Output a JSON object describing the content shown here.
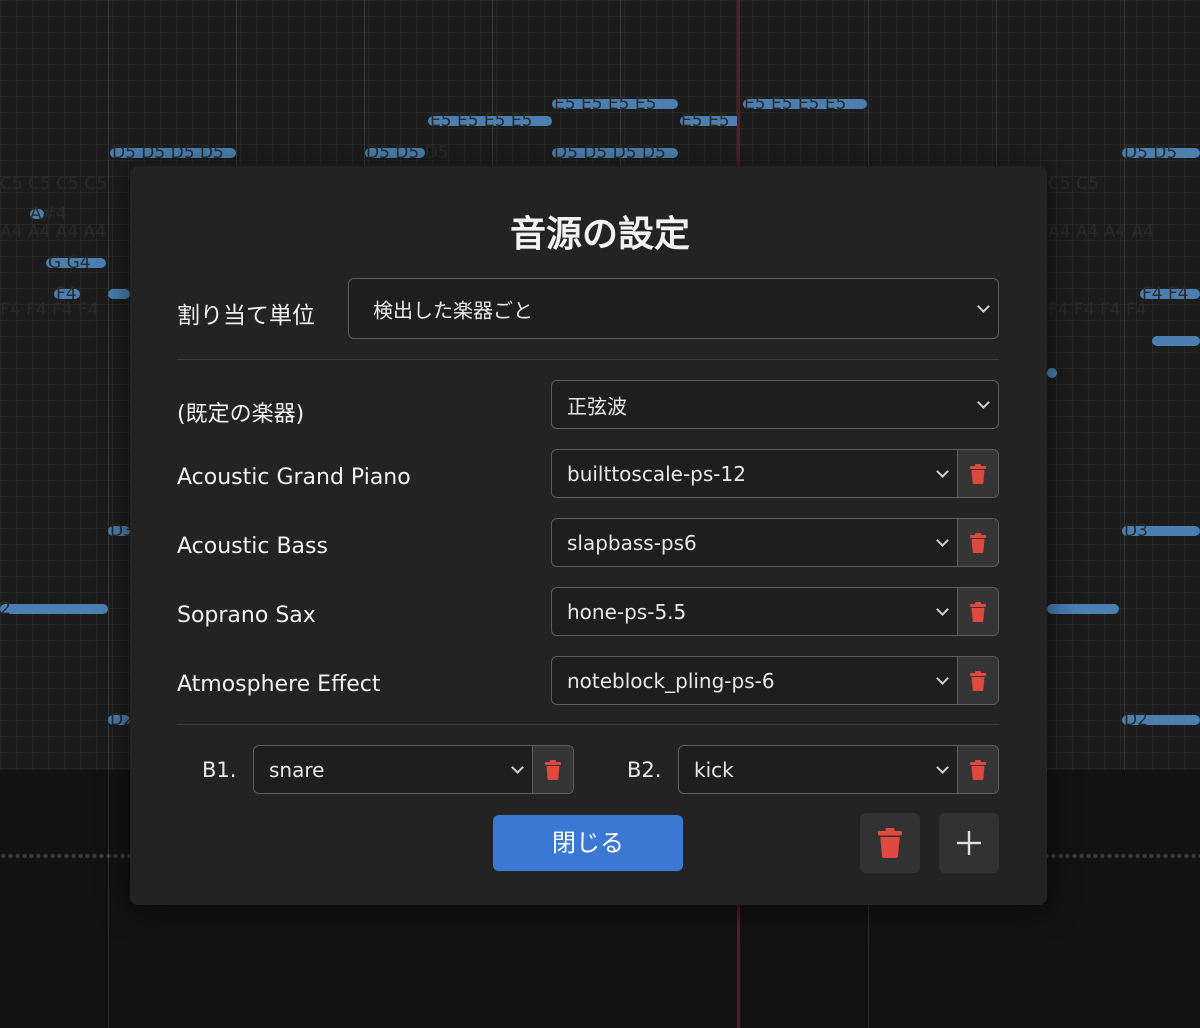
{
  "background": {
    "note_labels": [
      "E5 E5 E5 E5",
      "E5 E5 E5 E5",
      "E5 E5 E5 E5",
      "E5 E5",
      "E5 E5 E5 E5",
      "D5 D5 D5 D5",
      "D5 D5 D5",
      "D5 D5 D5 D5",
      "D5 D5",
      "C5 C5 C5 C5",
      "C5 C5",
      "A#4",
      "A4 A4 A4 A4",
      "A4 A4 A4 A4",
      "G G4",
      "F4",
      "F4 F4 F4 F4",
      "F4 F4 F4 F4",
      "F4 F4",
      "D3",
      "D3",
      "D2",
      "D2",
      "2"
    ]
  },
  "dialog": {
    "title": "音源の設定",
    "assign_unit": {
      "label": "割り当て単位",
      "value": "検出した楽器ごと"
    },
    "default_instrument": {
      "label": "(既定の楽器)",
      "value": "正弦波"
    },
    "instruments": [
      {
        "name": "Acoustic Grand Piano",
        "sound": "builttoscale-ps-12"
      },
      {
        "name": "Acoustic Bass",
        "sound": "slapbass-ps6"
      },
      {
        "name": "Soprano Sax",
        "sound": "hone-ps-5.5"
      },
      {
        "name": "Atmosphere Effect",
        "sound": "noteblock_pling-ps-6"
      }
    ],
    "drums": [
      {
        "label": "B1.",
        "sound": "snare"
      },
      {
        "label": "B2.",
        "sound": "kick"
      }
    ],
    "close_label": "閉じる"
  },
  "colors": {
    "accent": "#3a78d4",
    "trash": "#e0493f",
    "modal_bg": "#232323",
    "note": "#4a7fb0"
  },
  "icons": {
    "select_arrow": "chevron-down-icon",
    "remove": "trash-icon",
    "add": "plus-icon"
  }
}
